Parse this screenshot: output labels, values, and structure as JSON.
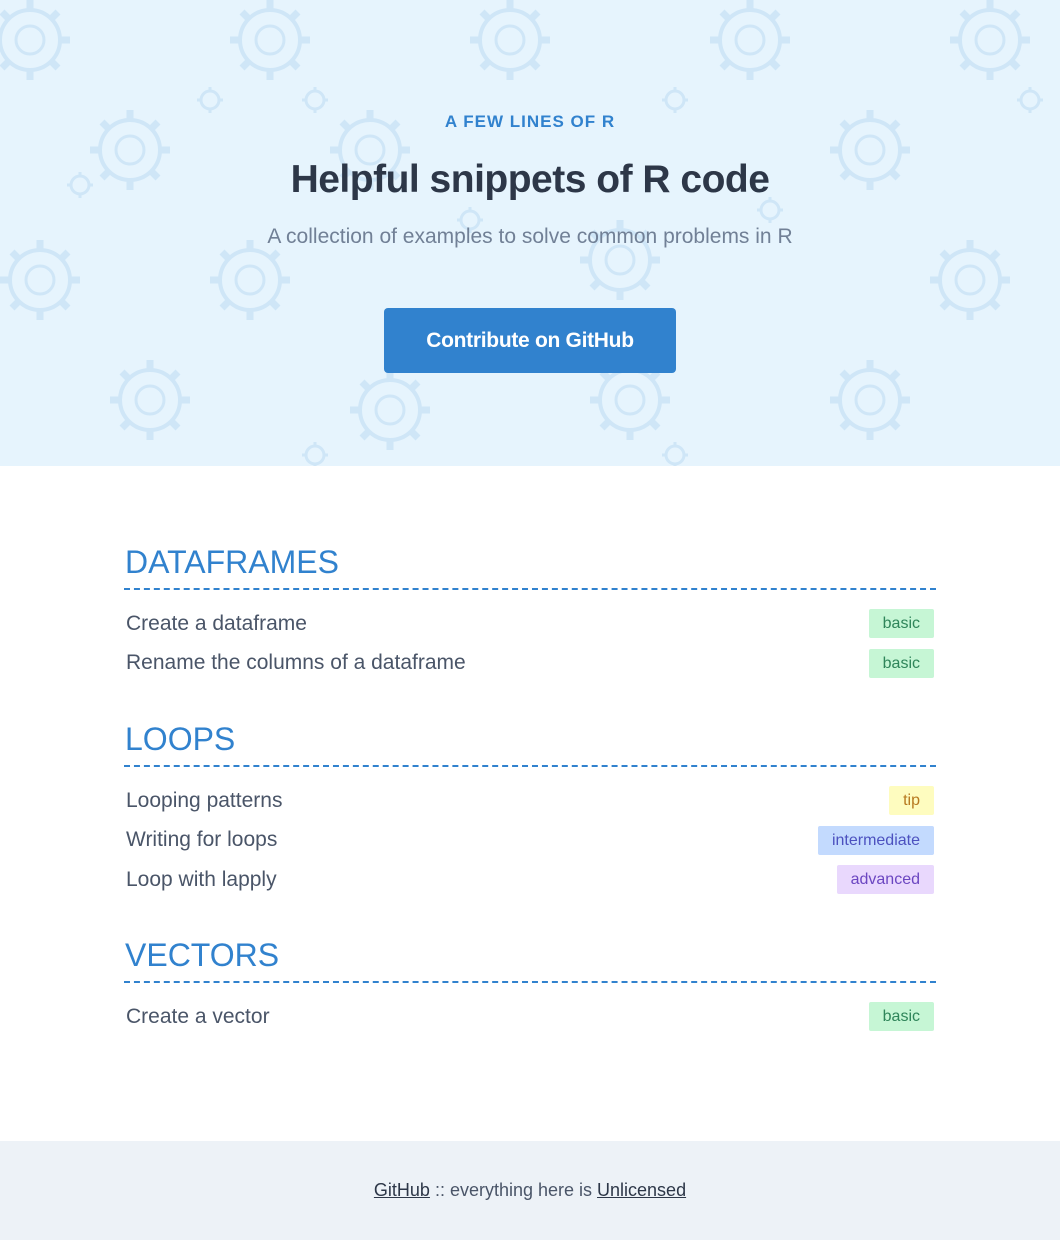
{
  "hero": {
    "eyebrow": "A FEW LINES OF R",
    "title": "Helpful snippets of R code",
    "subtitle": "A collection of examples to solve common problems in R",
    "cta_label": "Contribute on GitHub",
    "background_color": "#e6f4fd",
    "accent_color": "#3182ce"
  },
  "sections": [
    {
      "title": "DATAFRAMES",
      "items": [
        {
          "label": "Create a dataframe",
          "tag": "basic"
        },
        {
          "label": "Rename the columns of a dataframe",
          "tag": "basic"
        }
      ]
    },
    {
      "title": "LOOPS",
      "items": [
        {
          "label": "Looping patterns",
          "tag": "tip"
        },
        {
          "label": "Writing for loops",
          "tag": "intermediate"
        },
        {
          "label": "Loop with lapply",
          "tag": "advanced"
        }
      ]
    },
    {
      "title": "VECTORS",
      "items": [
        {
          "label": "Create a vector",
          "tag": "basic"
        }
      ]
    }
  ],
  "footer": {
    "github_link": "GitHub ",
    "separator": " :: everything here is ",
    "license_link": "Unlicensed"
  },
  "tag_colors": {
    "basic": "#c6f6d5",
    "tip": "#fefcbf",
    "intermediate": "#c3dafe",
    "advanced": "#e9d8fd"
  }
}
